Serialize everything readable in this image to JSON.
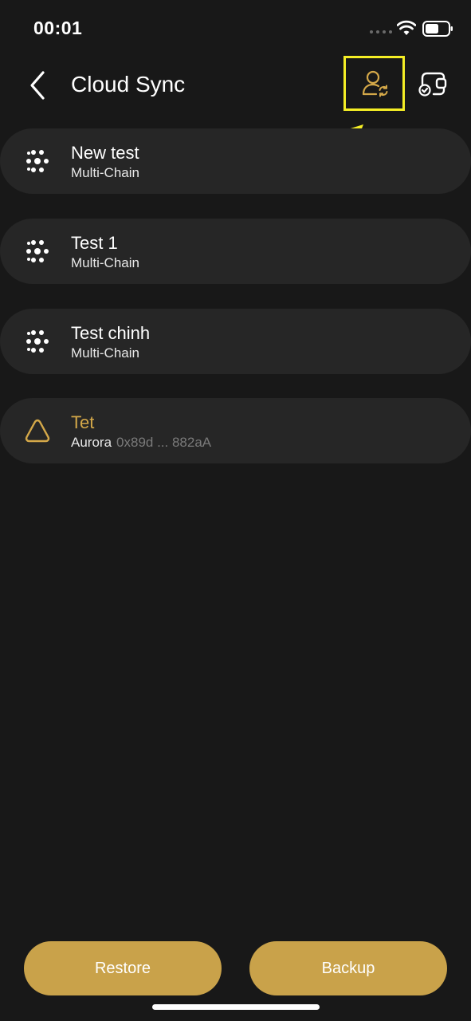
{
  "status_bar": {
    "time": "00:01"
  },
  "header": {
    "title": "Cloud Sync",
    "back_icon": "chevron-left-icon",
    "actions": [
      {
        "icon": "user-sync-icon",
        "highlighted": true
      },
      {
        "icon": "wallet-check-icon"
      }
    ]
  },
  "wallets": [
    {
      "name": "New test",
      "subtitle": "Multi-Chain",
      "icon": "multichain-dots-icon"
    },
    {
      "name": "Test 1",
      "subtitle": "Multi-Chain",
      "icon": "multichain-dots-icon"
    },
    {
      "name": "Test chinh",
      "subtitle": "Multi-Chain",
      "icon": "multichain-dots-icon"
    },
    {
      "name": "Tet",
      "subtitle": "Aurora",
      "address": "0x89d ... 882aA",
      "icon": "aurora-triangle-icon"
    }
  ],
  "buttons": {
    "restore": "Restore",
    "backup": "Backup"
  },
  "colors": {
    "background": "#181818",
    "card": "#262626",
    "accent": "#c9a24a",
    "annotation": "#f5ee25"
  }
}
